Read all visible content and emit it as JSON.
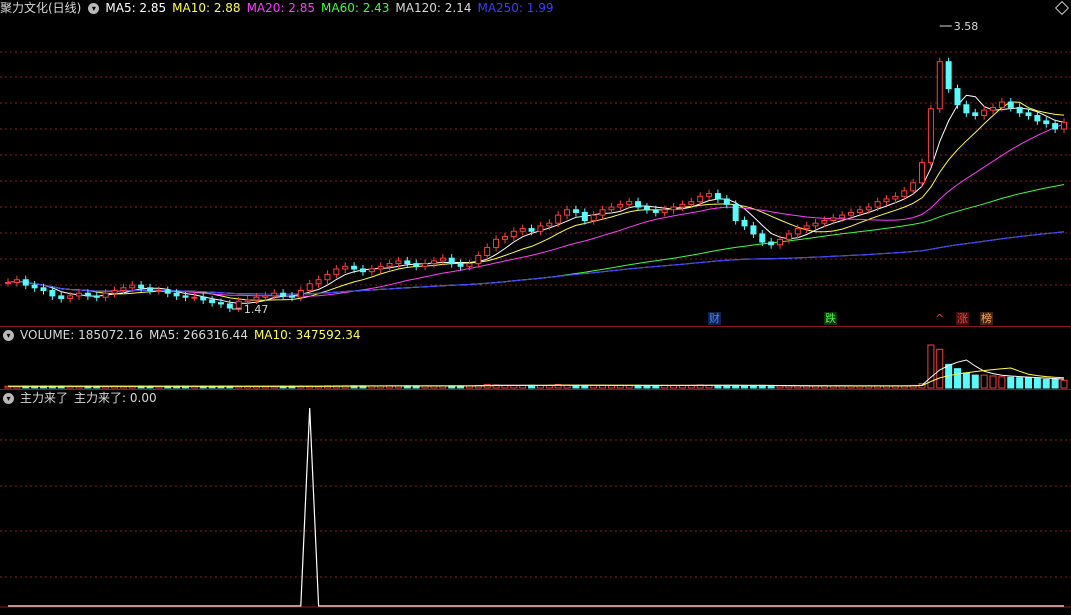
{
  "price_panel": {
    "title": "聚力文化(日线)",
    "indicators": [
      {
        "label": "MA5: 2.85",
        "color": "#ffffff"
      },
      {
        "label": "MA10: 2.88",
        "color": "#ffff3c"
      },
      {
        "label": "MA20: 2.85",
        "color": "#ff3cff"
      },
      {
        "label": "MA60: 2.43",
        "color": "#3cff3c"
      },
      {
        "label": "MA120: 2.14",
        "color": "#d8d8d8"
      },
      {
        "label": "MA250: 1.99",
        "color": "#3c3cff"
      }
    ],
    "high_label": "3.58",
    "low_label": "1.47",
    "event_markers": [
      {
        "text": "财",
        "color": "#3c8cff",
        "bg": "#102050"
      },
      {
        "text": "跌",
        "color": "#3cff3c",
        "bg": "#103010"
      },
      {
        "text": "^",
        "color": "#ff3c3c",
        "bg": "#000000"
      },
      {
        "text": "涨",
        "color": "#ff3c3c",
        "bg": "#401010"
      },
      {
        "text": "榜",
        "color": "#ffaa3c",
        "bg": "#402010"
      }
    ]
  },
  "volume_panel": {
    "indicators": [
      {
        "label": "VOLUME: 185072.16",
        "color": "#d8d8d8"
      },
      {
        "label": "MA5: 266316.44",
        "color": "#d8d8d8"
      },
      {
        "label": "MA10: 347592.34",
        "color": "#ffff3c"
      }
    ]
  },
  "custom_panel": {
    "indicators": [
      {
        "label": "主力来了",
        "color": "#d8d8d8"
      },
      {
        "label": "主力来了: 0.00",
        "color": "#d8d8d8"
      }
    ]
  },
  "colors": {
    "up": "#ff3c3c",
    "down": "#54fcfc",
    "grid": "#8c1b1b",
    "background": "#000000"
  },
  "chart_data": {
    "type": "candlestick",
    "price_range": [
      1.47,
      3.58
    ],
    "candles_note": "",
    "closes": [
      1.66,
      1.68,
      1.64,
      1.62,
      1.6,
      1.56,
      1.54,
      1.56,
      1.58,
      1.56,
      1.55,
      1.58,
      1.6,
      1.62,
      1.64,
      1.62,
      1.6,
      1.6,
      1.58,
      1.56,
      1.55,
      1.55,
      1.53,
      1.51,
      1.5,
      1.47,
      1.52,
      1.53,
      1.55,
      1.56,
      1.58,
      1.56,
      1.55,
      1.6,
      1.65,
      1.68,
      1.72,
      1.76,
      1.78,
      1.76,
      1.74,
      1.76,
      1.78,
      1.8,
      1.82,
      1.8,
      1.78,
      1.8,
      1.82,
      1.84,
      1.8,
      1.78,
      1.8,
      1.86,
      1.92,
      1.98,
      2.0,
      2.04,
      2.06,
      2.04,
      2.08,
      2.1,
      2.16,
      2.2,
      2.18,
      2.12,
      2.16,
      2.2,
      2.22,
      2.24,
      2.26,
      2.22,
      2.2,
      2.18,
      2.2,
      2.22,
      2.24,
      2.26,
      2.3,
      2.32,
      2.28,
      2.24,
      2.12,
      2.08,
      2.02,
      1.96,
      1.94,
      1.98,
      2.02,
      2.06,
      2.08,
      2.1,
      2.12,
      2.14,
      2.16,
      2.18,
      2.2,
      2.22,
      2.26,
      2.28,
      2.3,
      2.34,
      2.4,
      2.55,
      2.95,
      3.3,
      3.1,
      2.98,
      2.92,
      2.9,
      2.94,
      2.96,
      3.0,
      2.96,
      2.92,
      2.9,
      2.86,
      2.84,
      2.8,
      2.85
    ],
    "volume": [
      0.04,
      0.04,
      0.04,
      0.04,
      0.04,
      0.04,
      0.04,
      0.04,
      0.04,
      0.04,
      0.04,
      0.04,
      0.04,
      0.04,
      0.04,
      0.04,
      0.04,
      0.04,
      0.04,
      0.04,
      0.04,
      0.04,
      0.04,
      0.04,
      0.04,
      0.04,
      0.04,
      0.04,
      0.04,
      0.04,
      0.04,
      0.04,
      0.04,
      0.04,
      0.04,
      0.04,
      0.05,
      0.05,
      0.05,
      0.05,
      0.05,
      0.05,
      0.05,
      0.05,
      0.05,
      0.05,
      0.05,
      0.05,
      0.05,
      0.05,
      0.05,
      0.05,
      0.05,
      0.06,
      0.08,
      0.07,
      0.06,
      0.06,
      0.06,
      0.06,
      0.06,
      0.06,
      0.08,
      0.07,
      0.06,
      0.06,
      0.06,
      0.06,
      0.06,
      0.06,
      0.06,
      0.06,
      0.06,
      0.06,
      0.06,
      0.06,
      0.06,
      0.06,
      0.07,
      0.06,
      0.06,
      0.06,
      0.06,
      0.06,
      0.06,
      0.06,
      0.05,
      0.05,
      0.05,
      0.05,
      0.05,
      0.05,
      0.05,
      0.05,
      0.05,
      0.05,
      0.05,
      0.05,
      0.05,
      0.05,
      0.05,
      0.05,
      0.06,
      0.1,
      1.0,
      0.9,
      0.55,
      0.45,
      0.35,
      0.3,
      0.3,
      0.28,
      0.26,
      0.25,
      0.24,
      0.24,
      0.22,
      0.2,
      0.2,
      0.18
    ],
    "signal": [
      0,
      0,
      0,
      0,
      0,
      0,
      0,
      0,
      0,
      0,
      0,
      0,
      0,
      0,
      0,
      0,
      0,
      0,
      0,
      0,
      0,
      0,
      0,
      0,
      0,
      0,
      0,
      0,
      0,
      0,
      0,
      0,
      0,
      0,
      1,
      0,
      0,
      0,
      0,
      0,
      0,
      0,
      0,
      0,
      0,
      0,
      0,
      0,
      0,
      0,
      0,
      0,
      0,
      0,
      0,
      0,
      0,
      0,
      0,
      0,
      0,
      0,
      0,
      0,
      0,
      0,
      0,
      0,
      0,
      0,
      0,
      0,
      0,
      0,
      0,
      0,
      0,
      0,
      0,
      0,
      0,
      0,
      0,
      0,
      0,
      0,
      0,
      0,
      0,
      0,
      0,
      0,
      0,
      0,
      0,
      0,
      0,
      0,
      0,
      0,
      0,
      0,
      0,
      0,
      0,
      0,
      0,
      0,
      0,
      0,
      0,
      0,
      0,
      0,
      0,
      0,
      0,
      0,
      0,
      0
    ]
  }
}
